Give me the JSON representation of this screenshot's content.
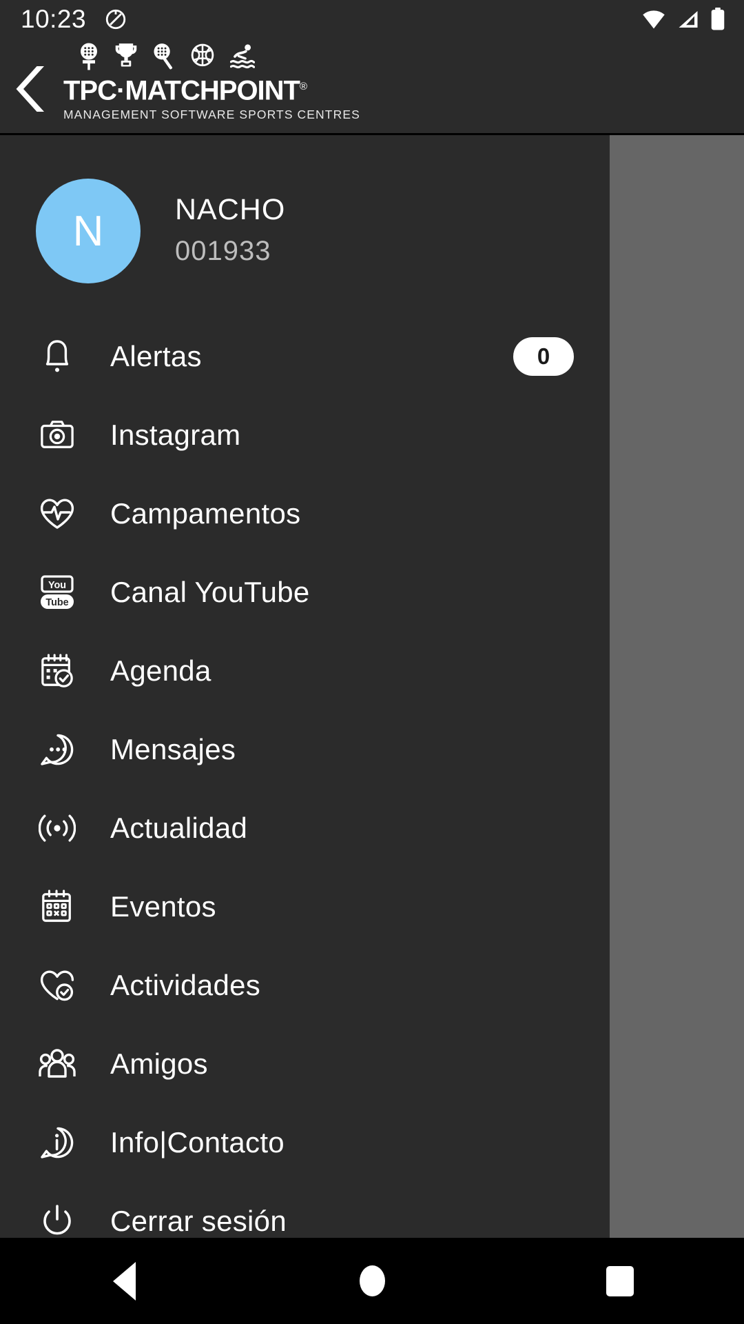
{
  "status_bar": {
    "time": "10:23",
    "left_icons": [
      "do-not-disturb-icon"
    ],
    "right_icons": [
      "wifi-icon",
      "cellular-signal-icon",
      "battery-icon"
    ]
  },
  "app_bar": {
    "back_label": "back-arrow",
    "sport_icons": [
      "padel-racket-icon",
      "trophy-icon",
      "tennis-racket-icon",
      "basketball-icon",
      "swimming-icon"
    ],
    "brand_name": "TPC·MATCHPOINT",
    "brand_registered": "®",
    "brand_tagline": "MANAGEMENT SOFTWARE SPORTS CENTRES"
  },
  "profile": {
    "avatar_initial": "N",
    "avatar_color": "#7ec8f5",
    "name": "NACHO",
    "member_id": "001933"
  },
  "menu": {
    "items": [
      {
        "label": "Alertas",
        "icon": "bell-icon",
        "badge": "0"
      },
      {
        "label": "Instagram",
        "icon": "camera-icon",
        "badge": null
      },
      {
        "label": "Campamentos",
        "icon": "heart-pulse-icon",
        "badge": null
      },
      {
        "label": "Canal YouTube",
        "icon": "youtube-icon",
        "badge": null
      },
      {
        "label": "Agenda",
        "icon": "calendar-check-icon",
        "badge": null
      },
      {
        "label": "Mensajes",
        "icon": "chat-bubble-icon",
        "badge": null
      },
      {
        "label": "Actualidad",
        "icon": "broadcast-icon",
        "badge": null
      },
      {
        "label": "Eventos",
        "icon": "calendar-grid-icon",
        "badge": null
      },
      {
        "label": "Actividades",
        "icon": "heart-check-icon",
        "badge": null
      },
      {
        "label": "Amigos",
        "icon": "people-group-icon",
        "badge": null
      },
      {
        "label": "Info|Contacto",
        "icon": "info-bubble-icon",
        "badge": null
      },
      {
        "label": "Cerrar sesión",
        "icon": "power-icon",
        "badge": null
      }
    ]
  },
  "nav_bar": {
    "back_label": "back-triangle-icon",
    "home_label": "home-circle-icon",
    "recents_label": "recents-square-icon"
  },
  "colors": {
    "drawer_background": "#2b2b2b",
    "scrim": "#666666",
    "accent": "#7ec8f5",
    "text_primary": "#ffffff",
    "text_secondary": "#bdbdbd"
  }
}
